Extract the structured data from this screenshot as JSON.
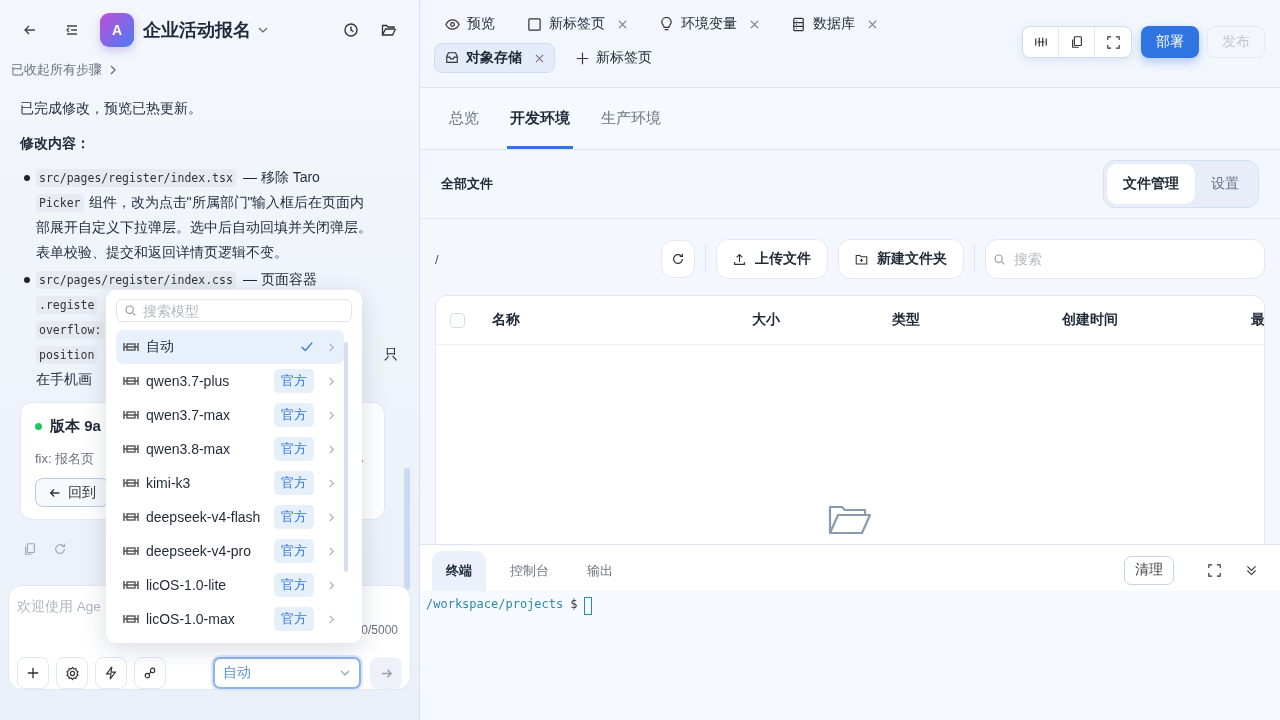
{
  "sidebar": {
    "app_initial": "A",
    "app_name": "企业活动报名",
    "steps_toggle": "已收起所有步骤"
  },
  "message": {
    "intro": "已完成修改，预览已热更新。",
    "heading": "修改内容：",
    "bullets": [
      {
        "lines": [
          [
            {
              "kind": "code",
              "text": "src/pages/register/index.tsx"
            },
            {
              "kind": "text",
              "text": "— 移除 Taro"
            }
          ],
          [
            {
              "kind": "code",
              "text": "Picker"
            },
            {
              "kind": "text",
              "text": "组件，改为点击\"所属部门\"输入框后在页面内"
            }
          ],
          [
            {
              "kind": "text",
              "text": "部展开自定义下拉弹层。选中后自动回填并关闭弹层。"
            }
          ],
          [
            {
              "kind": "text",
              "text": "表单校验、提交和返回详情页逻辑不变。"
            }
          ]
        ]
      },
      {
        "lines": [
          [
            {
              "kind": "code",
              "text": "src/pages/register/index.css"
            },
            {
              "kind": "text",
              "text": "— 页面容器"
            }
          ],
          [
            {
              "kind": "code",
              "text": ".registe"
            }
          ],
          [
            {
              "kind": "code",
              "text": "overflow:"
            }
          ],
          [
            {
              "kind": "code",
              "text": "position"
            },
            {
              "kind": "tail",
              "text": "只"
            }
          ],
          [
            {
              "kind": "text",
              "text": "在手机画"
            }
          ]
        ]
      }
    ]
  },
  "version_card": {
    "title": "版本 9a",
    "summary": "fix: 报名页",
    "summary_tail": ".",
    "button": "回到"
  },
  "composer": {
    "placeholder": "欢迎使用 Age",
    "count": "0/5000",
    "model_select": "自动"
  },
  "model_menu": {
    "search_placeholder": "搜索模型",
    "models": [
      {
        "name": "自动",
        "selected": true
      },
      {
        "name": "qwen3.7-plus",
        "badge": "官方",
        "selected": false
      },
      {
        "name": "qwen3.7-max",
        "badge": "官方",
        "selected": false
      },
      {
        "name": "qwen3.8-max",
        "badge": "官方",
        "selected": false
      },
      {
        "name": "kimi-k3",
        "badge": "官方",
        "selected": false
      },
      {
        "name": "deepseek-v4-flash",
        "badge": "官方",
        "selected": false
      },
      {
        "name": "deepseek-v4-pro",
        "badge": "官方",
        "selected": false
      },
      {
        "name": "licOS-1.0-lite",
        "badge": "官方",
        "selected": false
      },
      {
        "name": "licOS-1.0-max",
        "badge": "官方",
        "selected": false
      }
    ]
  },
  "tab_rows": [
    [
      {
        "label": "预览",
        "closable": false,
        "selected": false
      },
      {
        "label": "新标签页",
        "closable": true,
        "selected": false
      },
      {
        "label": "环境变量",
        "closable": true,
        "selected": false
      },
      {
        "label": "数据库",
        "closable": true,
        "selected": false
      }
    ],
    [
      {
        "label": "对象存储",
        "closable": true,
        "selected": true
      }
    ]
  ],
  "new_tab": "新标签页",
  "actions": {
    "deploy": "部署",
    "publish": "发布",
    "publish_disabled": true
  },
  "env_tabs": [
    {
      "label": "总览",
      "selected": false
    },
    {
      "label": "开发环境",
      "selected": true
    },
    {
      "label": "生产环境",
      "selected": false
    }
  ],
  "files": {
    "title": "全部文件",
    "views": [
      {
        "label": "文件管理",
        "selected": true
      },
      {
        "label": "设置",
        "selected": false
      }
    ],
    "path": "/",
    "upload": "上传文件",
    "new_folder": "新建文件夹",
    "search_placeholder": "搜索",
    "columns": [
      "名称",
      "大小",
      "类型",
      "创建时间",
      "最"
    ],
    "select_all_checked": false
  },
  "terminal": {
    "tabs": [
      {
        "label": "终端",
        "selected": true
      },
      {
        "label": "控制台",
        "selected": false
      },
      {
        "label": "输出",
        "selected": false
      }
    ],
    "clear": "清理",
    "prompt_path": "/workspace/projects",
    "prompt_symbol": "$"
  }
}
